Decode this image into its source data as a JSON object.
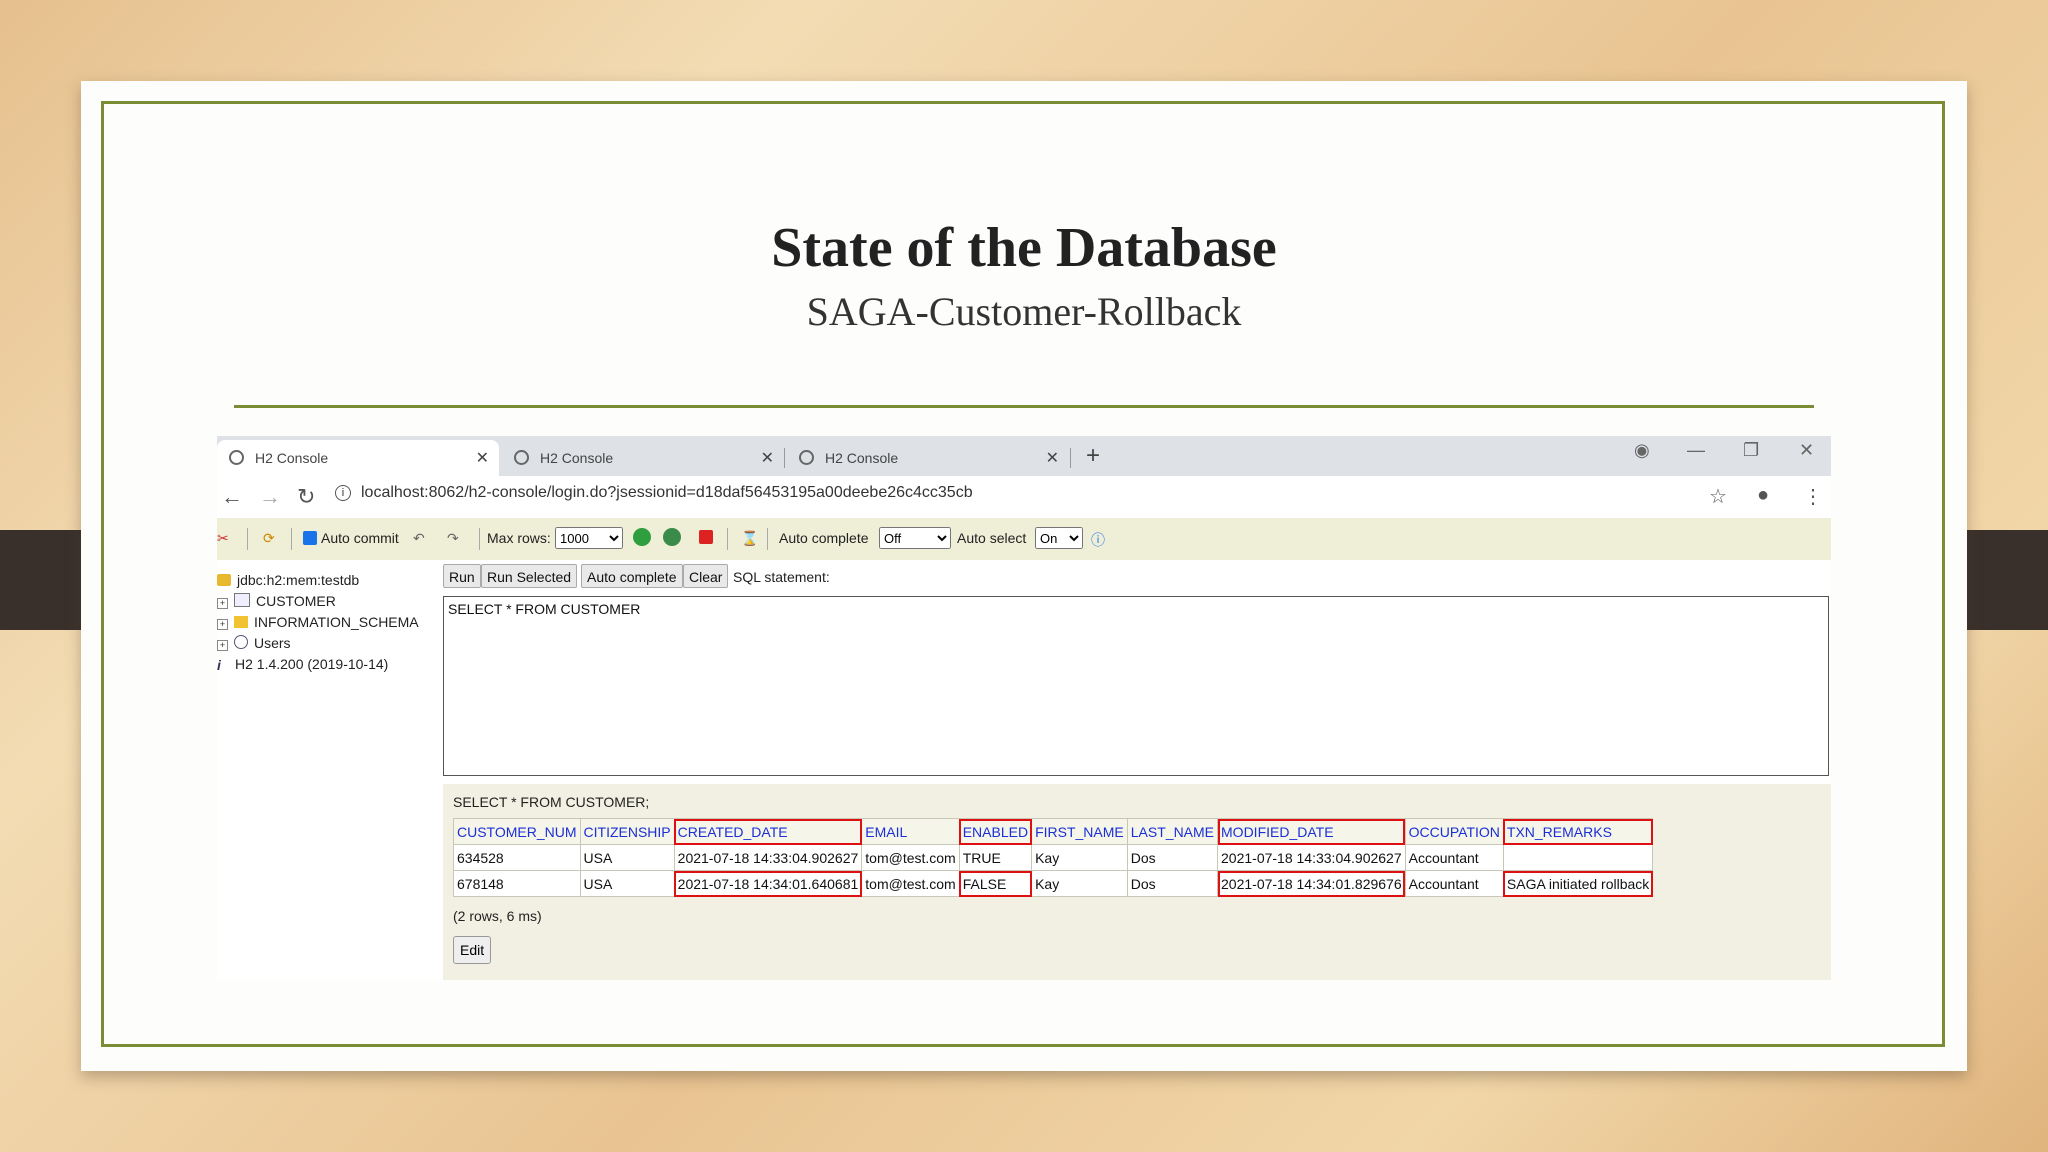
{
  "slide": {
    "title": "State of the Database",
    "subtitle": "SAGA-Customer-Rollback"
  },
  "browser": {
    "tabs": [
      {
        "label": "H2 Console",
        "close": "✕",
        "active": true
      },
      {
        "label": "H2 Console",
        "close": "✕",
        "active": false
      },
      {
        "label": "H2 Console",
        "close": "✕",
        "active": false
      }
    ],
    "new_tab": "+",
    "url": "localhost:8062/h2-console/login.do?jsessionid=d18daf56453195a00deebe26c4cc35cb"
  },
  "h2_toolbar": {
    "auto_commit_label": "Auto commit",
    "max_rows_label": "Max rows:",
    "max_rows_value": "1000",
    "auto_complete_label": "Auto complete",
    "auto_complete_value": "Off",
    "auto_select_label": "Auto select",
    "auto_select_value": "On"
  },
  "sidebar": {
    "connection": "jdbc:h2:mem:testdb",
    "items": [
      "CUSTOMER",
      "INFORMATION_SCHEMA",
      "Users"
    ],
    "version": "H2 1.4.200 (2019-10-14)"
  },
  "query": {
    "buttons": {
      "run": "Run",
      "run_selected": "Run Selected",
      "auto_complete": "Auto complete",
      "clear": "Clear"
    },
    "sql_label": "SQL statement:",
    "sql_text": "SELECT * FROM CUSTOMER"
  },
  "results": {
    "title": "SELECT * FROM CUSTOMER;",
    "columns": [
      "CUSTOMER_NUM",
      "CITIZENSHIP",
      "CREATED_DATE",
      "EMAIL",
      "ENABLED",
      "FIRST_NAME",
      "LAST_NAME",
      "MODIFIED_DATE",
      "OCCUPATION",
      "TXN_REMARKS"
    ],
    "rows": [
      [
        "634528",
        "USA",
        "2021-07-18 14:33:04.902627",
        "tom@test.com",
        "TRUE",
        "Kay",
        "Dos",
        "2021-07-18 14:33:04.902627",
        "Accountant",
        ""
      ],
      [
        "678148",
        "USA",
        "2021-07-18 14:34:01.640681",
        "tom@test.com",
        "FALSE",
        "Kay",
        "Dos",
        "2021-07-18 14:34:01.829676",
        "Accountant",
        "SAGA initiated rollback"
      ]
    ],
    "row_count": "(2 rows, 6 ms)",
    "edit_label": "Edit"
  },
  "colors": {
    "frame_green": "#7a8c34",
    "highlight_red": "#dd1111",
    "header_blue": "#1a2fd6"
  }
}
